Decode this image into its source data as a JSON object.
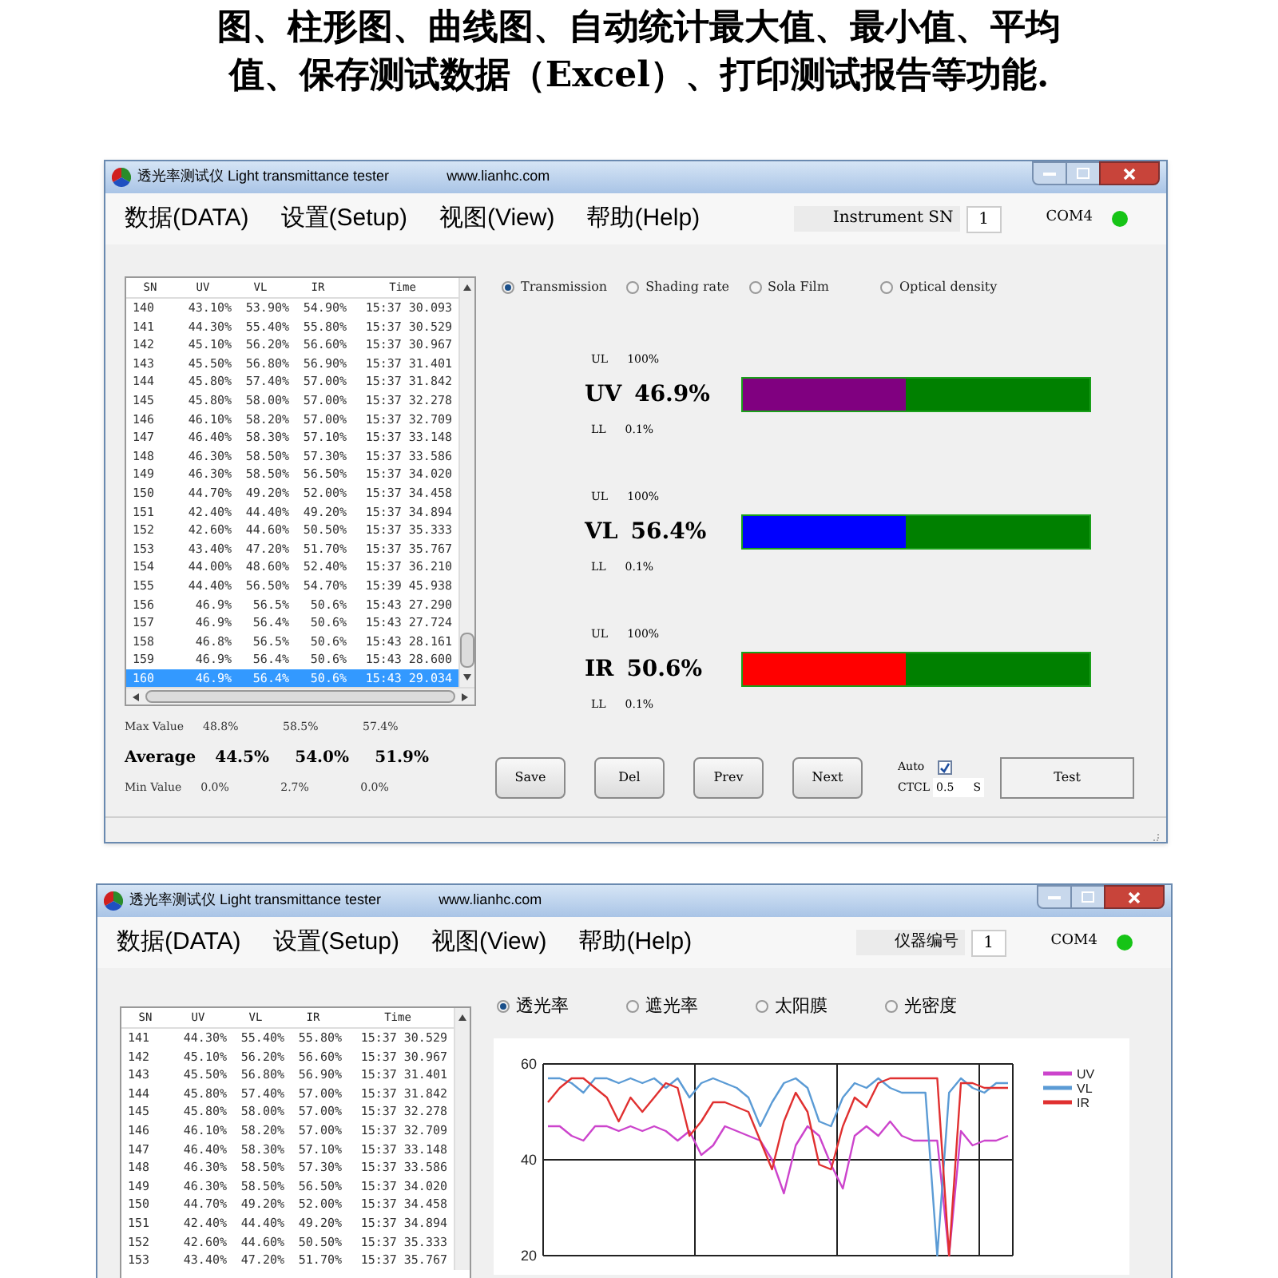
{
  "heading": {
    "lines": [
      "图、柱形图、曲线图、自动统计最大值、最小值、平均",
      "值、保存测试数据（Excel）、打印测试报告等功能."
    ]
  },
  "bar_window": {
    "title": "透光率测试仪 Light transmittance tester",
    "site": "www.lianhc.com",
    "menus": [
      "数据(DATA)",
      "设置(Setup)",
      "视图(View)",
      "帮助(Help)"
    ],
    "instrument_label": "Instrument SN",
    "instrument_sn": "1",
    "port": "COM4",
    "connected": true,
    "columns": [
      "SN",
      "UV",
      "VL",
      "IR",
      "Time"
    ],
    "rows": [
      {
        "cells": [
          "140",
          "43.10%",
          "53.90%",
          "54.90%",
          "15:37 30.093"
        ],
        "selected": false
      },
      {
        "cells": [
          "141",
          "44.30%",
          "55.40%",
          "55.80%",
          "15:37 30.529"
        ],
        "selected": false
      },
      {
        "cells": [
          "142",
          "45.10%",
          "56.20%",
          "56.60%",
          "15:37 30.967"
        ],
        "selected": false
      },
      {
        "cells": [
          "143",
          "45.50%",
          "56.80%",
          "56.90%",
          "15:37 31.401"
        ],
        "selected": false
      },
      {
        "cells": [
          "144",
          "45.80%",
          "57.40%",
          "57.00%",
          "15:37 31.842"
        ],
        "selected": false
      },
      {
        "cells": [
          "145",
          "45.80%",
          "58.00%",
          "57.00%",
          "15:37 32.278"
        ],
        "selected": false
      },
      {
        "cells": [
          "146",
          "46.10%",
          "58.20%",
          "57.00%",
          "15:37 32.709"
        ],
        "selected": false
      },
      {
        "cells": [
          "147",
          "46.40%",
          "58.30%",
          "57.10%",
          "15:37 33.148"
        ],
        "selected": false
      },
      {
        "cells": [
          "148",
          "46.30%",
          "58.50%",
          "57.30%",
          "15:37 33.586"
        ],
        "selected": false
      },
      {
        "cells": [
          "149",
          "46.30%",
          "58.50%",
          "56.50%",
          "15:37 34.020"
        ],
        "selected": false
      },
      {
        "cells": [
          "150",
          "44.70%",
          "49.20%",
          "52.00%",
          "15:37 34.458"
        ],
        "selected": false
      },
      {
        "cells": [
          "151",
          "42.40%",
          "44.40%",
          "49.20%",
          "15:37 34.894"
        ],
        "selected": false
      },
      {
        "cells": [
          "152",
          "42.60%",
          "44.60%",
          "50.50%",
          "15:37 35.333"
        ],
        "selected": false
      },
      {
        "cells": [
          "153",
          "43.40%",
          "47.20%",
          "51.70%",
          "15:37 35.767"
        ],
        "selected": false
      },
      {
        "cells": [
          "154",
          "44.00%",
          "48.60%",
          "52.40%",
          "15:37 36.210"
        ],
        "selected": false
      },
      {
        "cells": [
          "155",
          "44.40%",
          "56.50%",
          "54.70%",
          "15:39 45.938"
        ],
        "selected": false
      },
      {
        "cells": [
          "156",
          "46.9%",
          "56.5%",
          "50.6%",
          "15:43 27.290"
        ],
        "selected": false
      },
      {
        "cells": [
          "157",
          "46.9%",
          "56.4%",
          "50.6%",
          "15:43 27.724"
        ],
        "selected": false
      },
      {
        "cells": [
          "158",
          "46.8%",
          "56.5%",
          "50.6%",
          "15:43 28.161"
        ],
        "selected": false
      },
      {
        "cells": [
          "159",
          "46.9%",
          "56.4%",
          "50.6%",
          "15:43 28.600"
        ],
        "selected": false
      },
      {
        "cells": [
          "160",
          "46.9%",
          "56.4%",
          "50.6%",
          "15:43 29.034"
        ],
        "selected": true
      }
    ],
    "stats": [
      {
        "kind": "max",
        "label": "Max Value",
        "values": [
          "48.8%",
          "58.5%",
          "57.4%"
        ]
      },
      {
        "kind": "average",
        "label": "Average",
        "values": [
          "44.5%",
          "54.0%",
          "51.9%"
        ]
      },
      {
        "kind": "min",
        "label": "Min Value",
        "values": [
          "0.0%",
          "2.7%",
          "0.0%"
        ]
      }
    ],
    "modes": [
      {
        "label": "Transmission",
        "selected": true
      },
      {
        "label": "Shading rate",
        "selected": false
      },
      {
        "label": "Sola Film",
        "selected": false
      },
      {
        "label": "Optical density",
        "selected": false
      }
    ],
    "meters": [
      {
        "name": "UV",
        "reading": "46.9%",
        "ul_label": "UL",
        "ul": "100%",
        "ll_label": "LL",
        "ll": "0.1%",
        "level": 0.469,
        "color": "#800080"
      },
      {
        "name": "VL",
        "reading": "56.4%",
        "ul_label": "UL",
        "ul": "100%",
        "ll_label": "LL",
        "ll": "0.1%",
        "level": 0.469,
        "color": "#0000ff"
      },
      {
        "name": "IR",
        "reading": "50.6%",
        "ul_label": "UL",
        "ul": "100%",
        "ll_label": "LL",
        "ll": "0.1%",
        "level": 0.469,
        "color": "#ff0000"
      }
    ],
    "buttons": [
      "Save",
      "Del",
      "Prev",
      "Next"
    ],
    "auto": {
      "label": "Auto",
      "checked": true
    },
    "cycle": {
      "label": "CTCL",
      "value": "0.5",
      "unit": "S"
    },
    "test_button": "Test"
  },
  "chart_window": {
    "title": "透光率测试仪 Light transmittance tester",
    "site": "www.lianhc.com",
    "menus": [
      "数据(DATA)",
      "设置(Setup)",
      "视图(View)",
      "帮助(Help)"
    ],
    "instrument_label": "仪器编号",
    "instrument_sn": "1",
    "port": "COM4",
    "connected": true,
    "columns": [
      "SN",
      "UV",
      "VL",
      "IR",
      "Time"
    ],
    "rows": [
      {
        "cells": [
          "141",
          "44.30%",
          "55.40%",
          "55.80%",
          "15:37 30.529"
        ],
        "selected": false
      },
      {
        "cells": [
          "142",
          "45.10%",
          "56.20%",
          "56.60%",
          "15:37 30.967"
        ],
        "selected": false
      },
      {
        "cells": [
          "143",
          "45.50%",
          "56.80%",
          "56.90%",
          "15:37 31.401"
        ],
        "selected": false
      },
      {
        "cells": [
          "144",
          "45.80%",
          "57.40%",
          "57.00%",
          "15:37 31.842"
        ],
        "selected": false
      },
      {
        "cells": [
          "145",
          "45.80%",
          "58.00%",
          "57.00%",
          "15:37 32.278"
        ],
        "selected": false
      },
      {
        "cells": [
          "146",
          "46.10%",
          "58.20%",
          "57.00%",
          "15:37 32.709"
        ],
        "selected": false
      },
      {
        "cells": [
          "147",
          "46.40%",
          "58.30%",
          "57.10%",
          "15:37 33.148"
        ],
        "selected": false
      },
      {
        "cells": [
          "148",
          "46.30%",
          "58.50%",
          "57.30%",
          "15:37 33.586"
        ],
        "selected": false
      },
      {
        "cells": [
          "149",
          "46.30%",
          "58.50%",
          "56.50%",
          "15:37 34.020"
        ],
        "selected": false
      },
      {
        "cells": [
          "150",
          "44.70%",
          "49.20%",
          "52.00%",
          "15:37 34.458"
        ],
        "selected": false
      },
      {
        "cells": [
          "151",
          "42.40%",
          "44.40%",
          "49.20%",
          "15:37 34.894"
        ],
        "selected": false
      },
      {
        "cells": [
          "152",
          "42.60%",
          "44.60%",
          "50.50%",
          "15:37 35.333"
        ],
        "selected": false
      },
      {
        "cells": [
          "153",
          "43.40%",
          "47.20%",
          "51.70%",
          "15:37 35.767"
        ],
        "selected": false
      }
    ],
    "modes": [
      {
        "label": "透光率",
        "selected": true
      },
      {
        "label": "遮光率",
        "selected": false
      },
      {
        "label": "太阳膜",
        "selected": false
      },
      {
        "label": "光密度",
        "selected": false
      }
    ],
    "chart_data": {
      "type": "line",
      "legend": true,
      "ylim": [
        20,
        60
      ],
      "yticks": [
        20,
        40,
        60
      ],
      "series": [
        {
          "name": "UV",
          "color": "#cc44cc",
          "values": [
            47,
            47,
            45,
            44,
            47,
            47,
            46,
            47,
            46,
            47,
            46,
            44,
            46,
            41,
            43,
            47,
            46,
            45,
            44,
            40,
            33,
            43,
            47,
            45,
            39,
            34,
            45,
            47,
            45,
            48,
            45,
            44,
            44,
            44,
            20,
            46,
            43,
            44,
            44,
            45
          ]
        },
        {
          "name": "VL",
          "color": "#5b9bd5",
          "values": [
            57,
            57,
            56,
            54,
            57,
            57,
            56,
            57,
            56,
            57,
            55,
            57,
            53,
            56,
            57,
            56,
            55,
            53,
            47,
            52,
            56,
            57,
            55,
            48,
            47,
            53,
            56,
            55,
            57,
            55,
            54,
            54,
            54,
            20,
            54,
            57,
            55,
            54,
            56,
            56
          ]
        },
        {
          "name": "IR",
          "color": "#e03030",
          "values": [
            52,
            55,
            57,
            57,
            55,
            53,
            48,
            53,
            50,
            53,
            56,
            55,
            45,
            48,
            52,
            52,
            51,
            50,
            44,
            38,
            48,
            54,
            50,
            39,
            38,
            47,
            53,
            51,
            56,
            57,
            57,
            57,
            57,
            57,
            20,
            56,
            56,
            55,
            55,
            55
          ]
        }
      ]
    }
  }
}
